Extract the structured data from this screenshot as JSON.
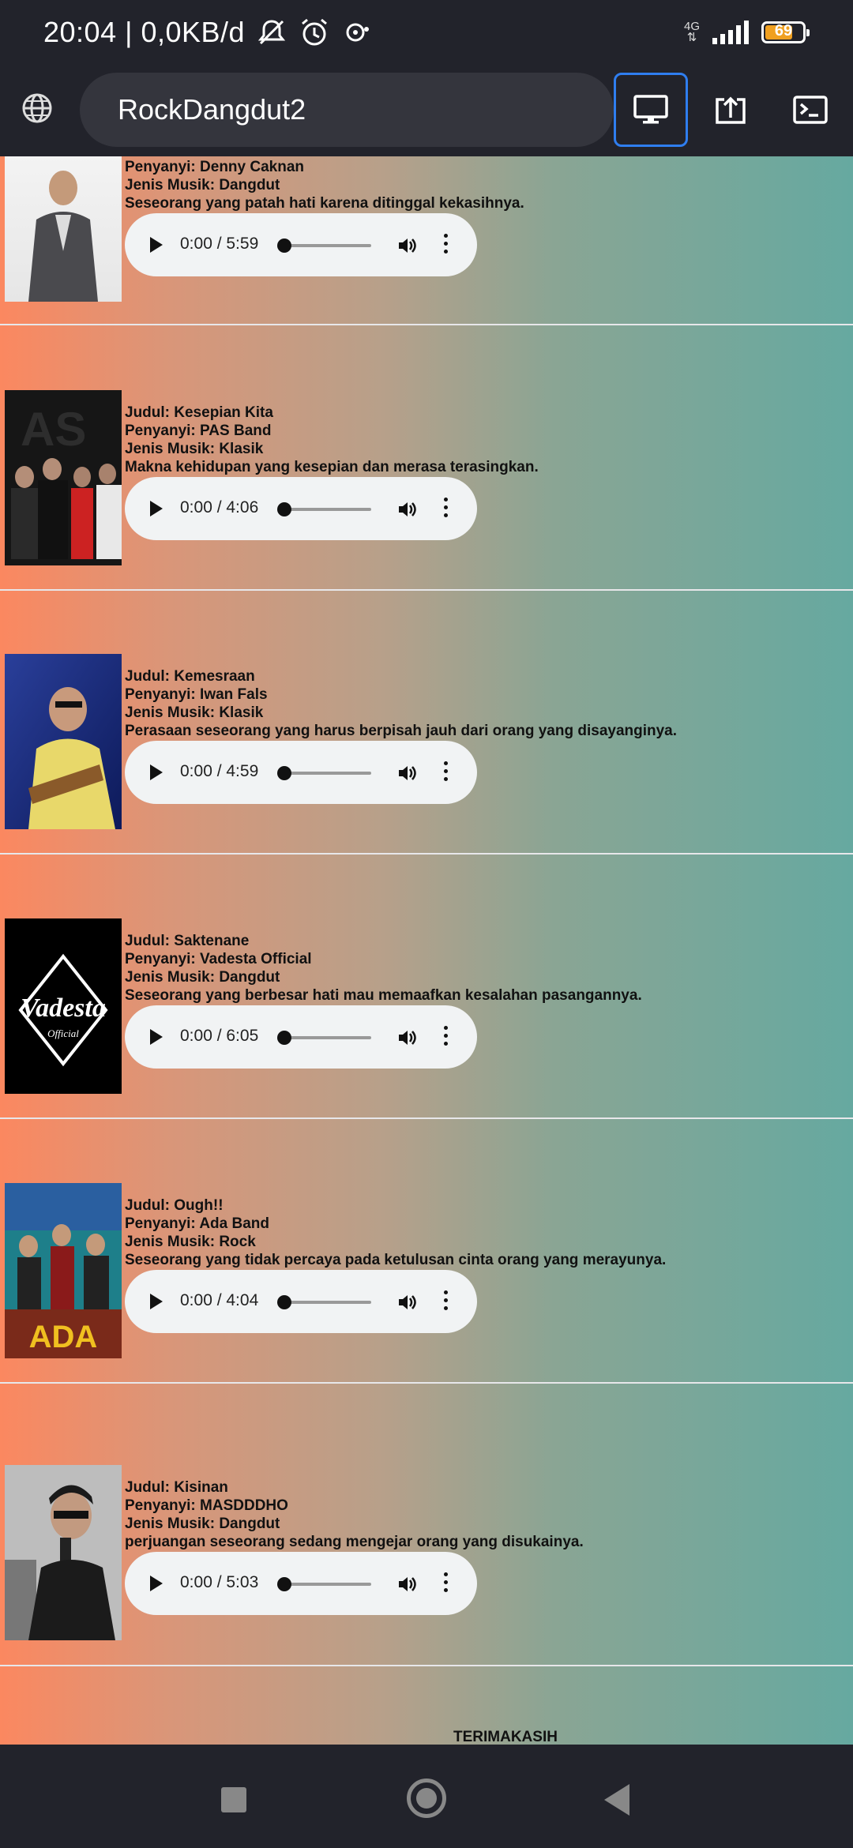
{
  "status_bar": {
    "time_text": "20:04 | 0,0KB/d",
    "network": "4G",
    "battery": "69"
  },
  "browser": {
    "title": "RockDangdut2"
  },
  "songs": [
    {
      "title": "",
      "singer": "Penyanyi: Denny Caknan",
      "genre": "Jenis Musik: Dangdut",
      "desc": "Seseorang yang patah hati karena ditinggal kekasihnya.",
      "time": "0:00 / 5:59"
    },
    {
      "title": "Judul: Kesepian Kita",
      "singer": "Penyanyi: PAS Band",
      "genre": "Jenis Musik: Klasik",
      "desc": "Makna kehidupan yang kesepian dan merasa terasingkan.",
      "time": "0:00 / 4:06"
    },
    {
      "title": "Judul: Kemesraan",
      "singer": "Penyanyi: Iwan Fals",
      "genre": "Jenis Musik: Klasik",
      "desc": "Perasaan seseorang yang harus berpisah jauh dari orang yang disayanginya.",
      "time": "0:00 / 4:59"
    },
    {
      "title": "Judul: Saktenane",
      "singer": "Penyanyi: Vadesta Official",
      "genre": "Jenis Musik: Dangdut",
      "desc": "Seseorang yang berbesar hati mau memaafkan kesalahan pasangannya.",
      "time": "0:00 / 6:05"
    },
    {
      "title": "Judul: Ough!!",
      "singer": "Penyanyi: Ada Band",
      "genre": "Jenis Musik: Rock",
      "desc": "Seseorang yang tidak percaya pada ketulusan cinta orang yang merayunya.",
      "time": "0:00 / 4:04"
    },
    {
      "title": "Judul: Kisinan",
      "singer": "Penyanyi: MASDDDHO",
      "genre": "Jenis Musik: Dangdut",
      "desc": "perjuangan seseorang sedang mengejar orang yang disukainya.",
      "time": "0:00 / 5:03"
    }
  ],
  "footer": {
    "text": "TERIMAKASIH"
  }
}
